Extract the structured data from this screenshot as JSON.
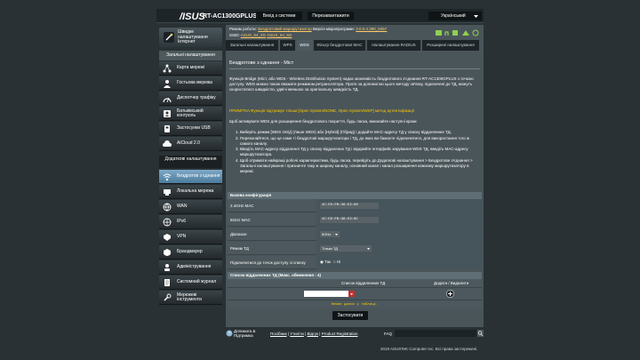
{
  "header": {
    "logo": "/ISUS",
    "model": "RT-AC1300GPLUS",
    "logout": "Вихід з системи",
    "reboot": "Перезавантажити",
    "language": "Український"
  },
  "status": {
    "mode_label": "Режим роботи:",
    "mode_value": "Бездротовий маршрутизатор",
    "firmware_label": "Версія мікропрограми:",
    "firmware_value": "3.0.0.4.380_8457",
    "ssid_label": "SSID:",
    "ssid_1": "ASUS_64_2G",
    "ssid_2": "ASUS_64_5G"
  },
  "sidebar": {
    "qis": "Швидке налаштування Інтернет",
    "general_header": "Загальні налаштування",
    "general_items": [
      {
        "label": "Карта мережі",
        "icon": "network-map-icon"
      },
      {
        "label": "Гостьова мережа",
        "icon": "guest-network-icon"
      },
      {
        "label": "Диспетчер трафіку",
        "icon": "traffic-manager-icon"
      },
      {
        "label": "Батьківський контроль",
        "icon": "parental-control-icon"
      },
      {
        "label": "Застосунки USB",
        "icon": "usb-icon"
      },
      {
        "label": "AiCloud 2.0",
        "icon": "cloud-icon"
      }
    ],
    "advanced_header": "Додаткові налаштування",
    "advanced_items": [
      {
        "label": "Бездротов з єднання",
        "icon": "wireless-icon"
      },
      {
        "label": "Локальна мережа",
        "icon": "lan-icon"
      },
      {
        "label": "WAN",
        "icon": "wan-icon"
      },
      {
        "label": "IPv6",
        "icon": "ipv6-icon"
      },
      {
        "label": "VPN",
        "icon": "vpn-icon"
      },
      {
        "label": "Брандмауер",
        "icon": "firewall-icon"
      },
      {
        "label": "Адміністрування",
        "icon": "admin-icon"
      },
      {
        "label": "Системний журнал",
        "icon": "log-icon"
      },
      {
        "label": "Мережеві інструменти",
        "icon": "tools-icon"
      }
    ]
  },
  "tabs": [
    "Загальні налаштування",
    "WPS",
    "WDS",
    "Фільтр бездротової MAC",
    "Налаштування RADIUS",
    "Розширені налаштування"
  ],
  "content": {
    "title": "Бездротове з єднання - Міст",
    "intro": "Функція Bridge (Міст, або WDS - Wireless Distribution System) надає можливість бездротового з'єднання RT-AC1300GPLUS з точкою доступу. WDS можна також вважати режимом ретранслятора. Проте за допомогою цього методу зв'язку, підключені до ТД, можуть скористатися швидкістю, удвічі меншою за оригінальну швидкість ТД.",
    "note": "ПРИМІТКА:Функція підтримує тільки [Open System/NONE, Open System/WEP] метод аутентифікації",
    "steps_intro": "Щоб активувати WDS для розширення бездротового покриття, будь ласка, виконайте наступні кроки",
    "steps": [
      "Виберіть режим [WDS Only] (Лише WDS) або [Hybrid] (Гібрид) і додайте MAC-адресу ТД у списку віддаленних ТД.",
      "Переконайтеся, що це саме ті бездротові маршрутизатори і ТД, до яких ви бажаєте підключитися, для використання того ж самого каналу.",
      "Введіть MAC-адресу віддаленої ТД у списку віддалених ТД і відкрийте інтерфейс керування WDS ТД, введіть MAC-адресу маршрутизатора.",
      "Щоб отримати найкращі робочі характеристики, будь ласка, перейдіть до Додаткові налаштування > Бездротове з'єднання > Загальні налаштування і призначте таку ж ширину каналу, основний канал і канал розширення кожному маршрутизатору в мережі."
    ]
  },
  "basic_config": {
    "header": "Базова конфігурація",
    "rows": [
      {
        "label": "2.4GHz MAC",
        "value": "4C:ED:FB:36:E3:60"
      },
      {
        "label": "5GHz MAC",
        "value": "4C:ED:FB:36:E3:6C"
      },
      {
        "label": "Діапазон",
        "value": "5GHz"
      },
      {
        "label": "Режим ТД",
        "value": "Тільки ТД"
      },
      {
        "label": "Підключитися до точок доступу зі списку",
        "yes": "Так",
        "no": "Ні"
      }
    ]
  },
  "remote_list": {
    "header": "Список віддаленних ТД (Макс. обмеження : 4)",
    "col_ap": "Список віддаленних ТД",
    "col_actions": "Додати / Видалити",
    "empty": "Немає даних у таблиці."
  },
  "apply": "Застосувати",
  "footer": {
    "help": "Допомога & Підтримка",
    "links": [
      "Посібник",
      "Утиліти",
      "Відгук",
      "Product Registration"
    ],
    "faq": "FAQ",
    "copyright": "2019 ASUSTeK Computer Inc. Всі права застережені."
  }
}
